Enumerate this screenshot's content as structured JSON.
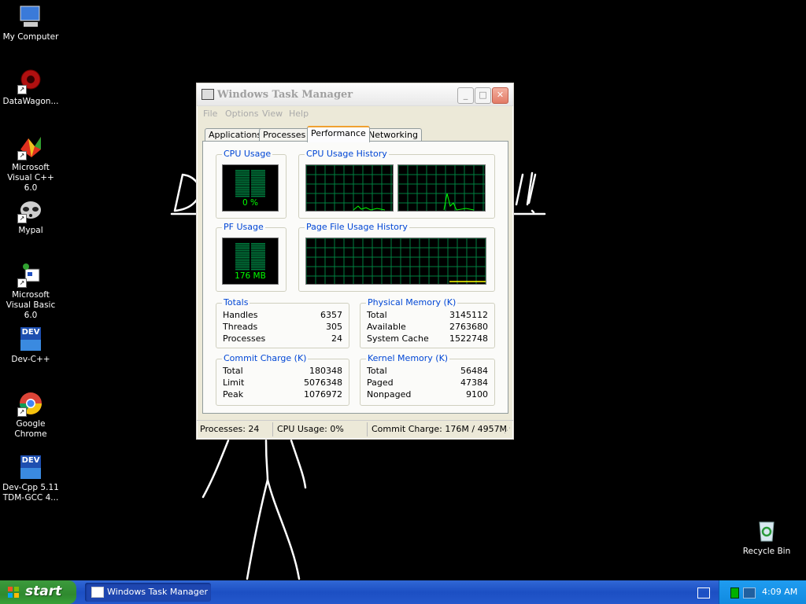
{
  "desktop": {
    "icons": [
      {
        "label": "My Computer"
      },
      {
        "label": "DataWagon..."
      },
      {
        "label": "Microsoft Visual C++ 6.0"
      },
      {
        "label": "Mypal"
      },
      {
        "label": "Microsoft Visual Basic 6.0"
      },
      {
        "label": "Dev-C++"
      },
      {
        "label": "Google Chrome"
      },
      {
        "label": "Dev-Cpp 5.11 TDM-GCC 4..."
      },
      {
        "label": "Recycle Bin"
      }
    ],
    "dev_badge": "DEV"
  },
  "window": {
    "title": "Windows Task Manager",
    "controls": {
      "minimize": "_",
      "maximize": "□",
      "close": "✕"
    },
    "menu": [
      "File",
      "Options",
      "View",
      "Help"
    ],
    "tabs": [
      "Applications",
      "Processes",
      "Performance",
      "Networking"
    ],
    "active_tab": "Performance",
    "cpu_usage": {
      "title": "CPU Usage",
      "value": "0 %",
      "percent": 0
    },
    "cpu_history": {
      "title": "CPU Usage History"
    },
    "pf_usage": {
      "title": "PF Usage",
      "value": "176 MB"
    },
    "page_file_history": {
      "title": "Page File Usage History"
    },
    "totals": {
      "title": "Totals",
      "rows": [
        {
          "k": "Handles",
          "v": "6357"
        },
        {
          "k": "Threads",
          "v": "305"
        },
        {
          "k": "Processes",
          "v": "24"
        }
      ]
    },
    "physical_memory": {
      "title": "Physical Memory (K)",
      "rows": [
        {
          "k": "Total",
          "v": "3145112"
        },
        {
          "k": "Available",
          "v": "2763680"
        },
        {
          "k": "System Cache",
          "v": "1522748"
        }
      ]
    },
    "commit_charge": {
      "title": "Commit Charge (K)",
      "rows": [
        {
          "k": "Total",
          "v": "180348"
        },
        {
          "k": "Limit",
          "v": "5076348"
        },
        {
          "k": "Peak",
          "v": "1076972"
        }
      ]
    },
    "kernel_memory": {
      "title": "Kernel Memory (K)",
      "rows": [
        {
          "k": "Total",
          "v": "56484"
        },
        {
          "k": "Paged",
          "v": "47384"
        },
        {
          "k": "Nonpaged",
          "v": "9100"
        }
      ]
    },
    "status": {
      "processes": "Processes: 24",
      "cpu": "CPU Usage: 0%",
      "commit": "Commit Charge: 176M / 4957M"
    }
  },
  "taskbar": {
    "start_label": "start",
    "task_item": "Windows Task Manager",
    "clock": "4:09 AM"
  },
  "colors": {
    "graph_green": "#00ff00",
    "grid_green": "#008040",
    "group_title_blue": "#0046d5",
    "pf_yellow": "#ffff00"
  }
}
